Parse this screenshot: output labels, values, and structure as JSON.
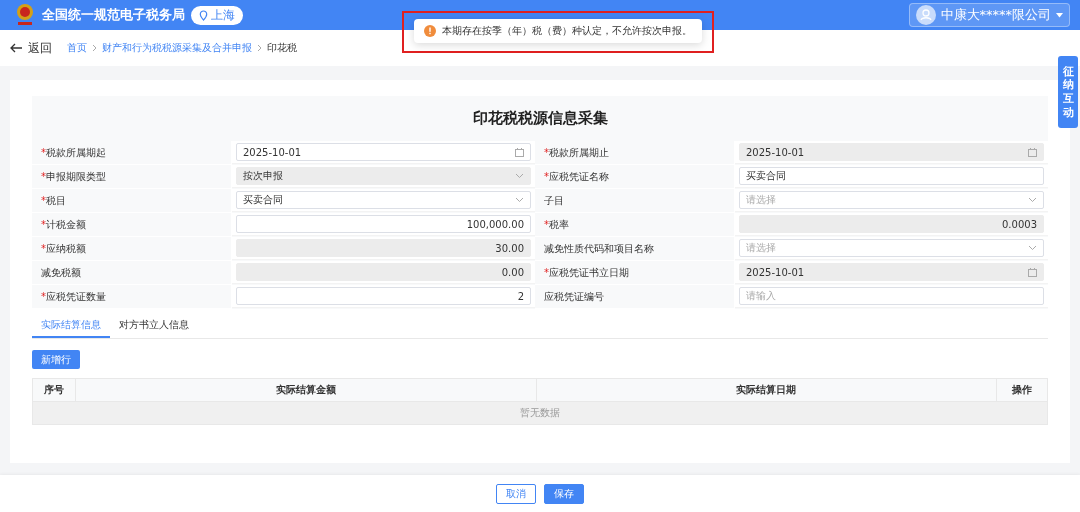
{
  "header": {
    "site_title": "全国统一规范电子税务局",
    "region": "上海",
    "company": "中康大*****限公司"
  },
  "toast": {
    "message": "本期存在按季（年）税（费）种认定，不允许按次申报。",
    "highlighted": true
  },
  "nav": {
    "back": "返回",
    "breadcrumb": [
      {
        "label": "首页",
        "link": true
      },
      {
        "label": "财产和行为税税源采集及合并申报",
        "link": true
      },
      {
        "label": "印花税",
        "link": false
      }
    ]
  },
  "side_tab": "征纳互动",
  "form": {
    "title": "印花税税源信息采集",
    "required_mark": "*",
    "fields": [
      {
        "label": "税款所属期起",
        "required": true,
        "kind": "date",
        "value": "2025-10-01",
        "disabled": false
      },
      {
        "label": "税款所属期止",
        "required": true,
        "kind": "date",
        "value": "2025-10-01",
        "disabled": true
      },
      {
        "label": "申报期限类型",
        "required": true,
        "kind": "select",
        "value": "按次申报",
        "disabled": true
      },
      {
        "label": "应税凭证名称",
        "required": true,
        "kind": "text",
        "value": "买卖合同",
        "disabled": false
      },
      {
        "label": "税目",
        "required": true,
        "kind": "select",
        "value": "买卖合同",
        "disabled": false
      },
      {
        "label": "子目",
        "required": false,
        "kind": "select",
        "placeholder": "请选择",
        "disabled": false
      },
      {
        "label": "计税金额",
        "required": true,
        "kind": "number",
        "value": "100,000.00",
        "disabled": false
      },
      {
        "label": "税率",
        "required": true,
        "kind": "number",
        "value": "0.0003",
        "disabled": true
      },
      {
        "label": "应纳税额",
        "required": true,
        "kind": "number",
        "value": "30.00",
        "disabled": true
      },
      {
        "label": "减免性质代码和项目名称",
        "required": false,
        "kind": "select",
        "placeholder": "请选择",
        "disabled": false
      },
      {
        "label": "减免税额",
        "required": false,
        "kind": "number",
        "value": "0.00",
        "disabled": true
      },
      {
        "label": "应税凭证书立日期",
        "required": true,
        "kind": "date",
        "value": "2025-10-01",
        "disabled": true
      },
      {
        "label": "应税凭证数量",
        "required": true,
        "kind": "number",
        "value": "2",
        "disabled": false
      },
      {
        "label": "应税凭证编号",
        "required": false,
        "kind": "text",
        "placeholder": "请输入",
        "disabled": false
      }
    ]
  },
  "tabs": [
    {
      "label": "实际结算信息",
      "selected": true
    },
    {
      "label": "对方书立人信息",
      "selected": false
    }
  ],
  "add_row_button": "新增行",
  "table": {
    "columns": [
      "序号",
      "实际结算金额",
      "实际结算日期",
      "操作"
    ],
    "empty_text": "暂无数据"
  },
  "footer_buttons": [
    {
      "label": "取消",
      "primary": false
    },
    {
      "label": "保存",
      "primary": true
    }
  ]
}
